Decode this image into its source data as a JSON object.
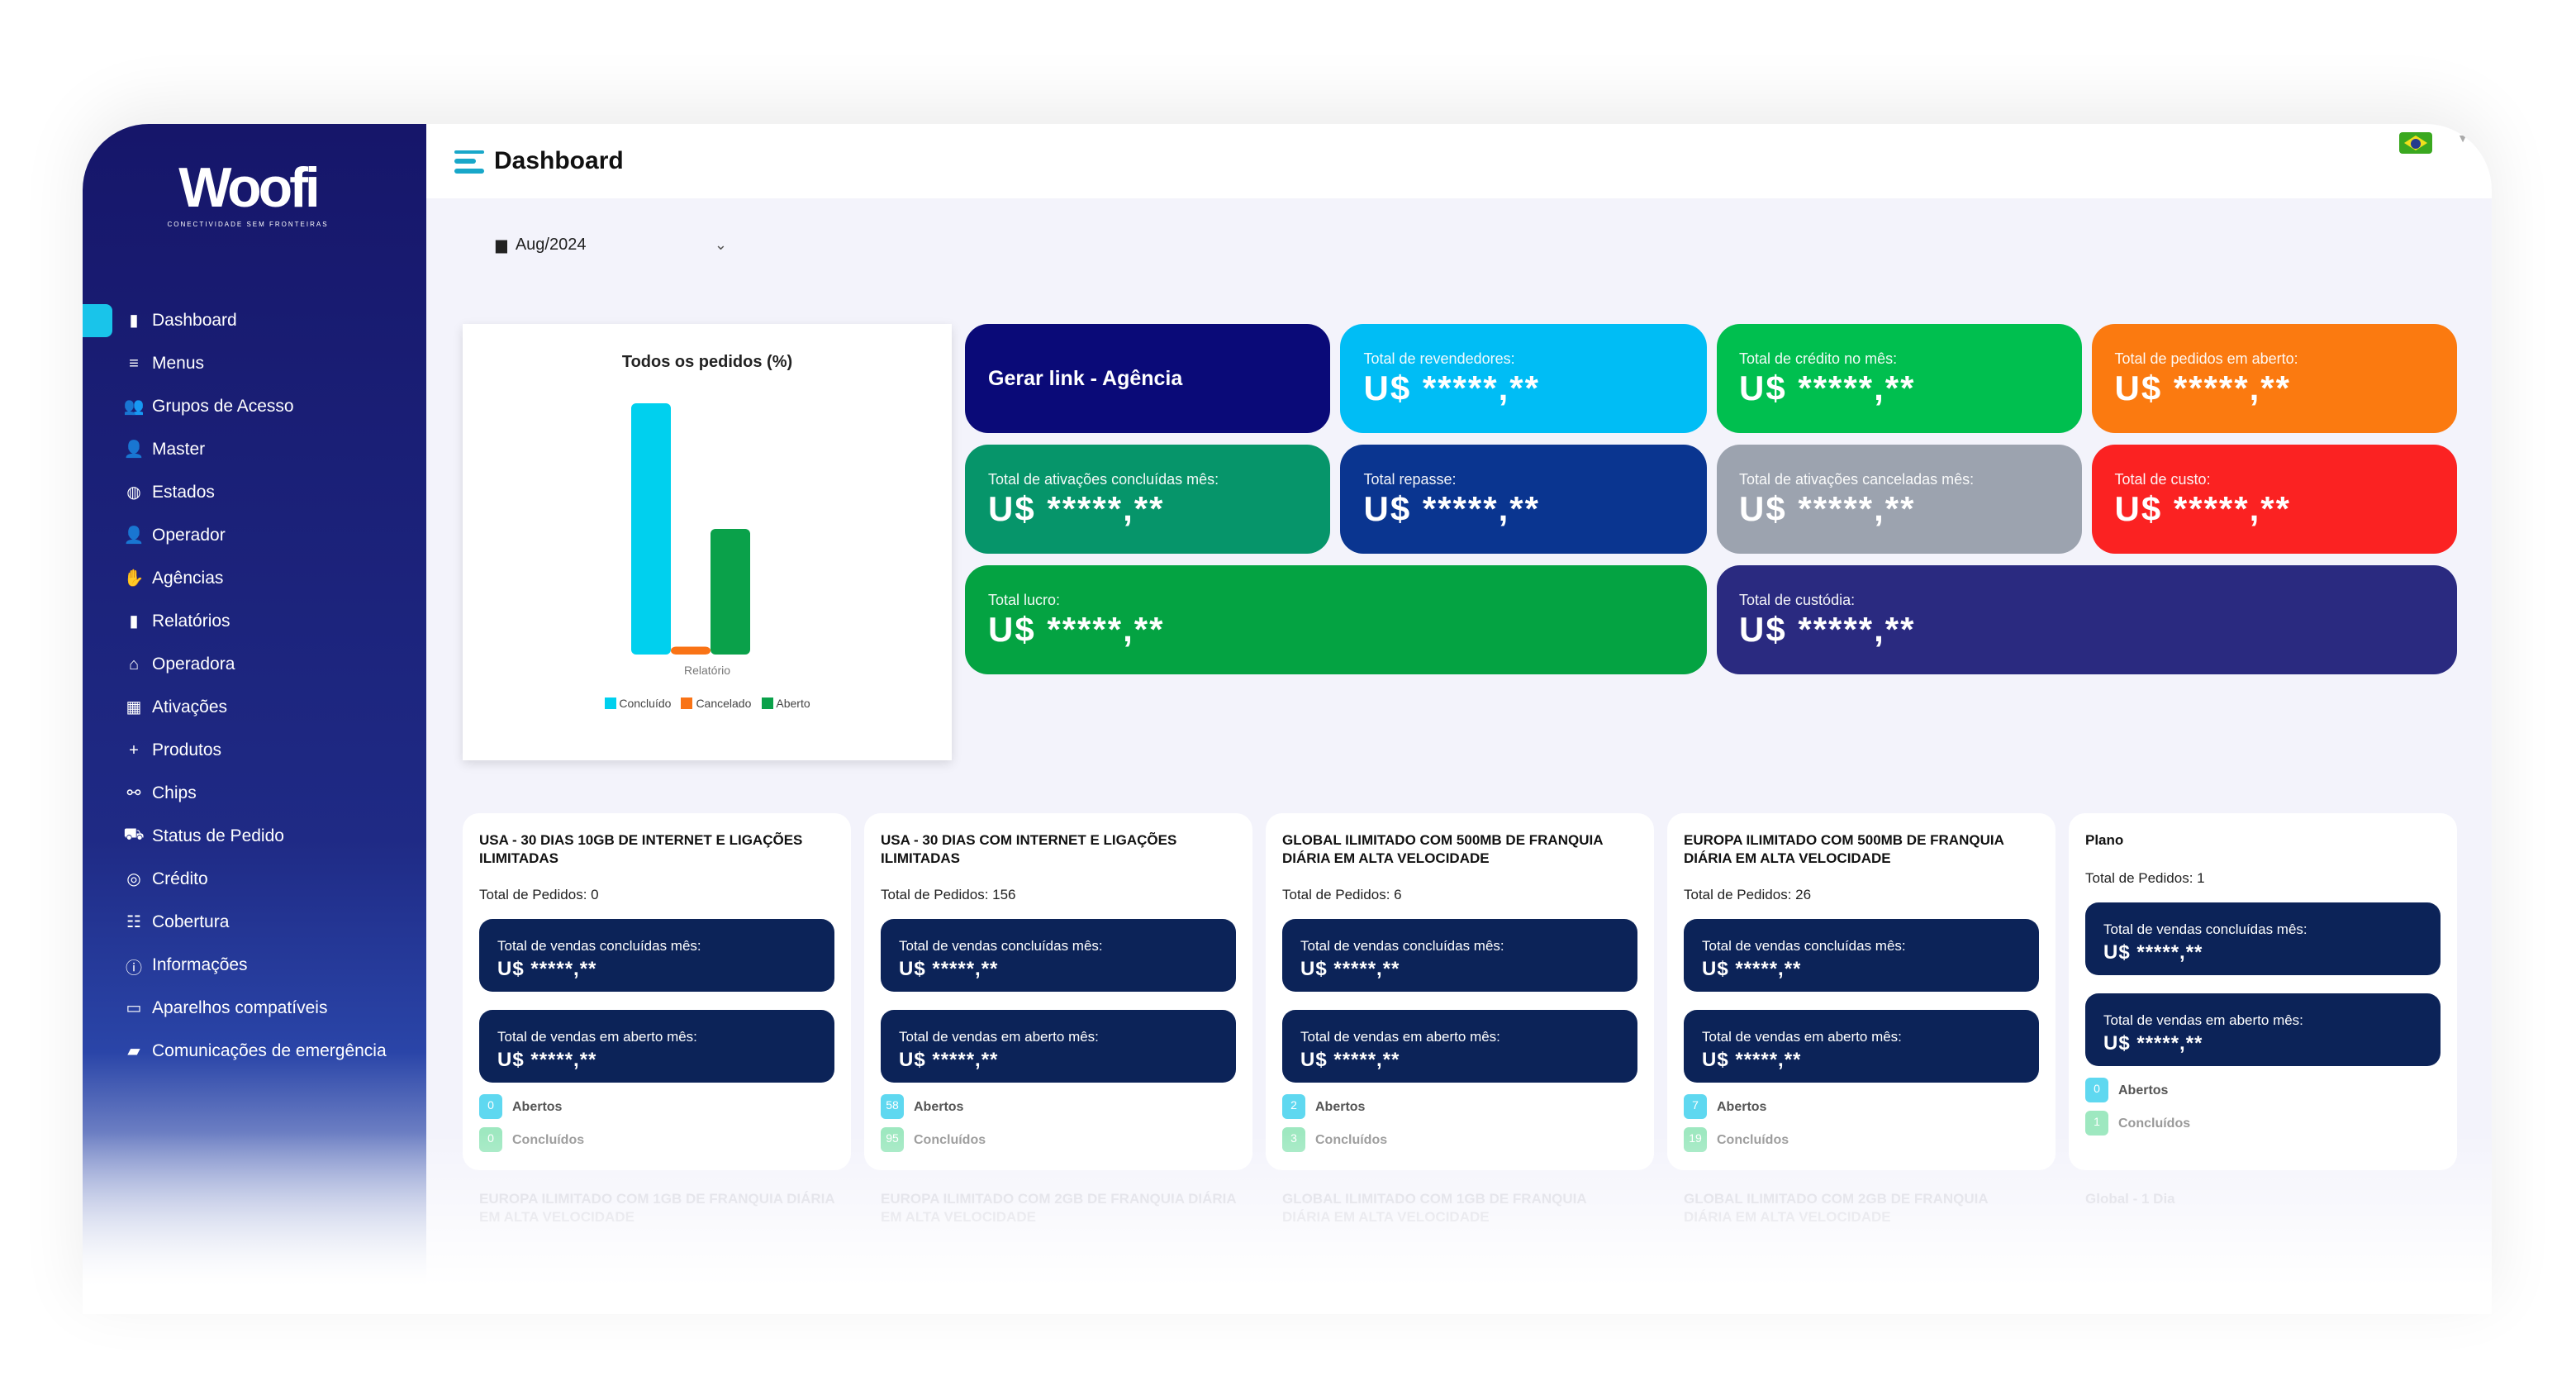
{
  "brand": {
    "logo": "Woofi",
    "tagline": "CONECTIVIDADE SEM FRONTEIRAS"
  },
  "header": {
    "title": "Dashboard",
    "language_flag": "brazil-flag"
  },
  "filter": {
    "month": "Aug/2024"
  },
  "sidebar": {
    "items": [
      {
        "label": "Dashboard",
        "icon": "bar-chart",
        "active": true
      },
      {
        "label": "Menus",
        "icon": "list"
      },
      {
        "label": "Grupos de Acesso",
        "icon": "users"
      },
      {
        "label": "Master",
        "icon": "user-tie"
      },
      {
        "label": "Estados",
        "icon": "globe"
      },
      {
        "label": "Operador",
        "icon": "user-tie"
      },
      {
        "label": "Agências",
        "icon": "hand-dollar"
      },
      {
        "label": "Relatórios",
        "icon": "bar-chart"
      },
      {
        "label": "Operadora",
        "icon": "store"
      },
      {
        "label": "Ativações",
        "icon": "calendar"
      },
      {
        "label": "Produtos",
        "icon": "plus"
      },
      {
        "label": "Chips",
        "icon": "sitemap"
      },
      {
        "label": "Status de Pedido",
        "icon": "truck"
      },
      {
        "label": "Crédito",
        "icon": "coins"
      },
      {
        "label": "Cobertura",
        "icon": "network"
      },
      {
        "label": "Informações",
        "icon": "info"
      },
      {
        "label": "Aparelhos compatíveis",
        "icon": "laptop"
      },
      {
        "label": "Comunicações de emergência",
        "icon": "comment"
      }
    ]
  },
  "chart_data": {
    "type": "bar",
    "title": "Todos os pedidos (%)",
    "xlabel": "Relatório",
    "categories": [
      "Relatório"
    ],
    "series": [
      {
        "name": "Concluído",
        "values": [
          64
        ],
        "color": "#00d0ee"
      },
      {
        "name": "Cancelado",
        "values": [
          2
        ],
        "color": "#f97316"
      },
      {
        "name": "Aberto",
        "values": [
          32
        ],
        "color": "#0aa14a"
      }
    ],
    "legend": "bottom",
    "grid": false
  },
  "stats": [
    {
      "label": "Gerar link - Agência",
      "color": "#0a0a78",
      "link": true
    },
    {
      "label": "Total de revendedores:",
      "value": "U$ *****,**",
      "color": "#00bdf5"
    },
    {
      "label": "Total de crédito no mês:",
      "value": "U$ *****,**",
      "color": "#00bf4f"
    },
    {
      "label": "Total de pedidos em aberto:",
      "value": "U$ *****,**",
      "color": "#fb7a10"
    },
    {
      "label": "Total de ativações concluídas mês:",
      "value": "U$ *****,**",
      "color": "#06956a"
    },
    {
      "label": "Total repasse:",
      "value": "U$ *****,**",
      "color": "#0a3590"
    },
    {
      "label": "Total de ativações canceladas mês:",
      "value": "U$ *****,**",
      "color": "#9ca3af"
    },
    {
      "label": "Total de custo:",
      "value": "U$ *****,**",
      "color": "#fb2222"
    },
    {
      "label": "Total lucro:",
      "value": "U$ *****,**",
      "color": "#04a342",
      "wide": true
    },
    {
      "label": "Total de custódia:",
      "value": "U$ *****,**",
      "color": "#2a2a80",
      "wide": true
    }
  ],
  "plans": [
    {
      "name": "USA - 30 DIAS 10GB DE INTERNET E LIGAÇÕES ILIMITADAS",
      "total": "Total de Pedidos: 0",
      "sold_label": "Total de vendas concluídas mês:",
      "sold": "U$ *****,**",
      "open_label": "Total de vendas em aberto mês:",
      "open": "U$ *****,**",
      "abertos": "0",
      "concluidos": "0"
    },
    {
      "name": "USA - 30 DIAS COM INTERNET E LIGAÇÕES ILIMITADAS",
      "total": "Total de Pedidos: 156",
      "sold_label": "Total de vendas concluídas mês:",
      "sold": "U$ *****,**",
      "open_label": "Total de vendas em aberto mês:",
      "open": "U$ *****,**",
      "abertos": "58",
      "concluidos": "95"
    },
    {
      "name": "GLOBAL ILIMITADO COM 500MB DE FRANQUIA DIÁRIA EM ALTA VELOCIDADE",
      "total": "Total de Pedidos: 6",
      "sold_label": "Total de vendas concluídas mês:",
      "sold": "U$ *****,**",
      "open_label": "Total de vendas em aberto mês:",
      "open": "U$ *****,**",
      "abertos": "2",
      "concluidos": "3"
    },
    {
      "name": "EUROPA ILIMITADO COM 500MB DE FRANQUIA DIÁRIA EM ALTA VELOCIDADE",
      "total": "Total de Pedidos: 26",
      "sold_label": "Total de vendas concluídas mês:",
      "sold": "U$ *****,**",
      "open_label": "Total de vendas em aberto mês:",
      "open": "U$ *****,**",
      "abertos": "7",
      "concluidos": "19"
    },
    {
      "name": "Plano",
      "total": "Total de Pedidos: 1",
      "sold_label": "Total de vendas concluídas mês:",
      "sold": "U$ *****,**",
      "open_label": "Total de vendas em aberto mês:",
      "open": "U$ *****,**",
      "abertos": "0",
      "concluidos": "1"
    }
  ],
  "labels": {
    "abertos": "Abertos",
    "concluidos": "Concluídos"
  },
  "plans_next": [
    "EUROPA ILIMITADO COM 1GB DE FRANQUIA DIÁRIA EM ALTA VELOCIDADE",
    "EUROPA ILIMITADO COM 2GB DE FRANQUIA DIÁRIA EM ALTA VELOCIDADE",
    "GLOBAL ILIMITADO COM 1GB DE FRANQUIA DIÁRIA EM ALTA VELOCIDADE",
    "GLOBAL ILIMITADO COM 2GB DE FRANQUIA DIÁRIA EM ALTA VELOCIDADE",
    "Global - 1 Dia"
  ]
}
